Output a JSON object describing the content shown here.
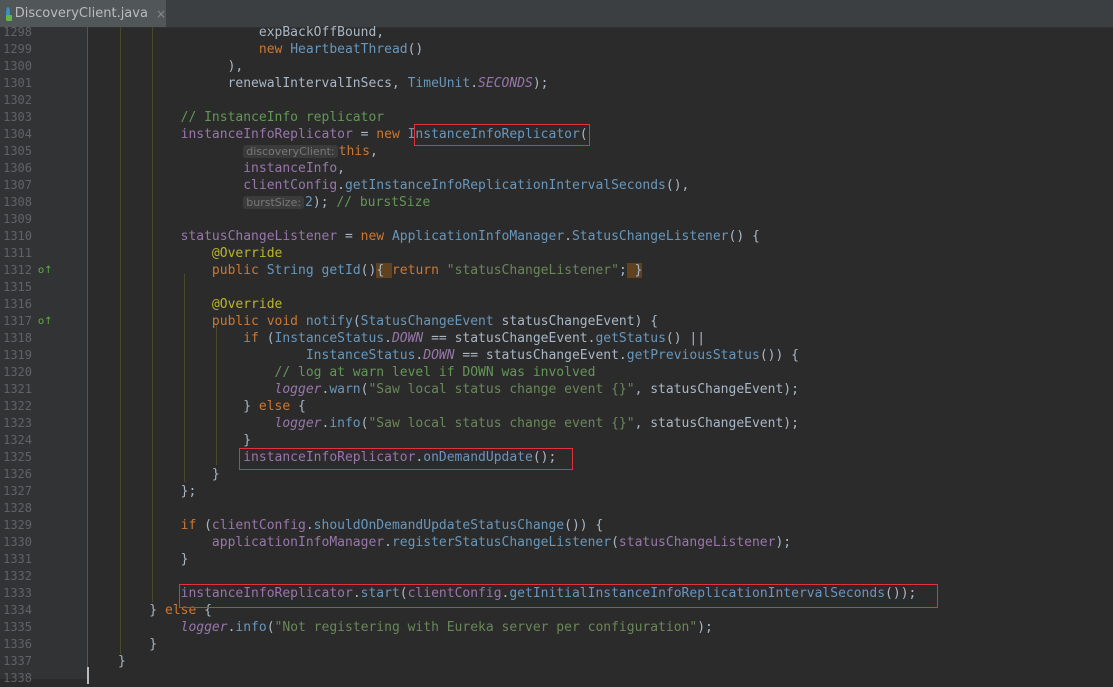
{
  "tab": {
    "title": "DiscoveryClient.java",
    "close": "×"
  },
  "lines": [
    {
      "n": "1298",
      "segs": [
        [
          "p",
          "                  expBackOffBound,"
        ]
      ]
    },
    {
      "n": "1299",
      "segs": [
        [
          "p",
          "                  "
        ],
        [
          "kw",
          "new "
        ],
        [
          "cls",
          "HeartbeatThread"
        ],
        [
          "p",
          "()"
        ]
      ]
    },
    {
      "n": "1300",
      "segs": [
        [
          "p",
          "              ),"
        ]
      ]
    },
    {
      "n": "1301",
      "segs": [
        [
          "p",
          "              renewalIntervalInSecs, "
        ],
        [
          "cls",
          "TimeUnit"
        ],
        [
          "p",
          "."
        ],
        [
          "con",
          "SECONDS"
        ],
        [
          "p",
          ");"
        ]
      ]
    },
    {
      "n": "1302",
      "segs": []
    },
    {
      "n": "1303",
      "segs": [
        [
          "cmt",
          "        // InstanceInfo replicator"
        ]
      ]
    },
    {
      "n": "1304",
      "segs": [
        [
          "fld",
          "        instanceInfoReplicator"
        ],
        [
          "p",
          " = "
        ],
        [
          "kw",
          "new "
        ],
        [
          "cls",
          "InstanceInfoReplicator"
        ],
        [
          "p",
          "("
        ]
      ]
    },
    {
      "n": "1305",
      "segs": [
        [
          "p",
          "                "
        ],
        [
          "hint",
          "discoveryClient:"
        ],
        [
          "kw",
          "this"
        ],
        [
          "p",
          ","
        ]
      ]
    },
    {
      "n": "1306",
      "segs": [
        [
          "fld",
          "                instanceInfo"
        ],
        [
          "p",
          ","
        ]
      ]
    },
    {
      "n": "1307",
      "segs": [
        [
          "fld",
          "                clientConfig"
        ],
        [
          "p",
          "."
        ],
        [
          "fn",
          "getInstanceInfoReplicationIntervalSeconds"
        ],
        [
          "p",
          "(),"
        ]
      ]
    },
    {
      "n": "1308",
      "segs": [
        [
          "p",
          "                "
        ],
        [
          "hint",
          "burstSize:"
        ],
        [
          "cls",
          "2"
        ],
        [
          "p",
          "); "
        ],
        [
          "cmt",
          "// burstSize"
        ]
      ]
    },
    {
      "n": "1309",
      "segs": []
    },
    {
      "n": "1310",
      "segs": [
        [
          "fld",
          "        statusChangeListener"
        ],
        [
          "p",
          " = "
        ],
        [
          "kw",
          "new "
        ],
        [
          "cls",
          "ApplicationInfoManager"
        ],
        [
          "p",
          "."
        ],
        [
          "cls",
          "StatusChangeListener"
        ],
        [
          "p",
          "() {"
        ]
      ]
    },
    {
      "n": "1311",
      "segs": [
        [
          "ann",
          "            @Override"
        ]
      ]
    },
    {
      "n": "1312",
      "segs": [
        [
          "kw",
          "            public "
        ],
        [
          "cls",
          "String "
        ],
        [
          "fn",
          "getId"
        ],
        [
          "p",
          "()"
        ],
        [
          "brace",
          "{ "
        ],
        [
          "kw",
          "return "
        ],
        [
          "str",
          "\"statusChangeListener\""
        ],
        [
          "p",
          ";"
        ],
        [
          "brace",
          " }"
        ]
      ]
    },
    {
      "n": "1315",
      "segs": []
    },
    {
      "n": "1316",
      "segs": [
        [
          "ann",
          "            @Override"
        ]
      ]
    },
    {
      "n": "1317",
      "segs": [
        [
          "kw",
          "            public void "
        ],
        [
          "fn",
          "notify"
        ],
        [
          "p",
          "("
        ],
        [
          "cls",
          "StatusChangeEvent "
        ],
        [
          "p",
          "statusChangeEvent) {"
        ]
      ]
    },
    {
      "n": "1318",
      "segs": [
        [
          "kw",
          "                if "
        ],
        [
          "p",
          "("
        ],
        [
          "cls",
          "InstanceStatus"
        ],
        [
          "p",
          "."
        ],
        [
          "con",
          "DOWN"
        ],
        [
          "p",
          " == statusChangeEvent."
        ],
        [
          "fn",
          "getStatus"
        ],
        [
          "p",
          "() ||"
        ]
      ]
    },
    {
      "n": "1319",
      "segs": [
        [
          "cls",
          "                        InstanceStatus"
        ],
        [
          "p",
          "."
        ],
        [
          "con",
          "DOWN"
        ],
        [
          "p",
          " == statusChangeEvent."
        ],
        [
          "fn",
          "getPreviousStatus"
        ],
        [
          "p",
          "()) {"
        ]
      ]
    },
    {
      "n": "1320",
      "segs": [
        [
          "cmt",
          "                    // log at warn level if DOWN was involved"
        ]
      ]
    },
    {
      "n": "1321",
      "segs": [
        [
          "con",
          "                    logger"
        ],
        [
          "p",
          "."
        ],
        [
          "fn",
          "warn"
        ],
        [
          "p",
          "("
        ],
        [
          "str",
          "\"Saw local status change event {}\""
        ],
        [
          "p",
          ", statusChangeEvent);"
        ]
      ]
    },
    {
      "n": "1322",
      "segs": [
        [
          "p",
          "                } "
        ],
        [
          "kw",
          "else "
        ],
        [
          "p",
          "{"
        ]
      ]
    },
    {
      "n": "1323",
      "segs": [
        [
          "con",
          "                    logger"
        ],
        [
          "p",
          "."
        ],
        [
          "fn",
          "info"
        ],
        [
          "p",
          "("
        ],
        [
          "str",
          "\"Saw local status change event {}\""
        ],
        [
          "p",
          ", statusChangeEvent);"
        ]
      ]
    },
    {
      "n": "1324",
      "segs": [
        [
          "p",
          "                }"
        ]
      ]
    },
    {
      "n": "1325",
      "segs": [
        [
          "fld",
          "                instanceInfoReplicator"
        ],
        [
          "p",
          "."
        ],
        [
          "fn",
          "onDemandUpdate"
        ],
        [
          "p",
          "();"
        ]
      ]
    },
    {
      "n": "1326",
      "segs": [
        [
          "p",
          "            }"
        ]
      ]
    },
    {
      "n": "1327",
      "segs": [
        [
          "p",
          "        };"
        ]
      ]
    },
    {
      "n": "1328",
      "segs": []
    },
    {
      "n": "1329",
      "segs": [
        [
          "kw",
          "        if "
        ],
        [
          "p",
          "("
        ],
        [
          "fld",
          "clientConfig"
        ],
        [
          "p",
          "."
        ],
        [
          "fn",
          "shouldOnDemandUpdateStatusChange"
        ],
        [
          "p",
          "()) {"
        ]
      ]
    },
    {
      "n": "1330",
      "segs": [
        [
          "fld",
          "            applicationInfoManager"
        ],
        [
          "p",
          "."
        ],
        [
          "fn",
          "registerStatusChangeListener"
        ],
        [
          "p",
          "("
        ],
        [
          "fld",
          "statusChangeListener"
        ],
        [
          "p",
          ");"
        ]
      ]
    },
    {
      "n": "1331",
      "segs": [
        [
          "p",
          "        }"
        ]
      ]
    },
    {
      "n": "1332",
      "segs": []
    },
    {
      "n": "1333",
      "segs": [
        [
          "fld",
          "        instanceInfoReplicator"
        ],
        [
          "p",
          "."
        ],
        [
          "fn",
          "start"
        ],
        [
          "p",
          "("
        ],
        [
          "fld",
          "clientConfig"
        ],
        [
          "p",
          "."
        ],
        [
          "fn",
          "getInitialInstanceInfoReplicationIntervalSeconds"
        ],
        [
          "p",
          "());"
        ]
      ]
    },
    {
      "n": "1334",
      "segs": [
        [
          "p",
          "    } "
        ],
        [
          "kw",
          "else "
        ],
        [
          "p",
          "{"
        ]
      ]
    },
    {
      "n": "1335",
      "segs": [
        [
          "con",
          "        logger"
        ],
        [
          "p",
          "."
        ],
        [
          "fn",
          "info"
        ],
        [
          "p",
          "("
        ],
        [
          "str",
          "\"Not registering with Eureka server per configuration\""
        ],
        [
          "p",
          ");"
        ]
      ]
    },
    {
      "n": "1336",
      "segs": [
        [
          "p",
          "    }"
        ]
      ]
    },
    {
      "n": "1337",
      "segs": [
        [
          "p",
          "}"
        ]
      ]
    },
    {
      "n": "1338",
      "segs": []
    }
  ],
  "markers": [
    {
      "line": "1312",
      "symbol": "o↑"
    },
    {
      "line": "1317",
      "symbol": "o↑"
    }
  ]
}
